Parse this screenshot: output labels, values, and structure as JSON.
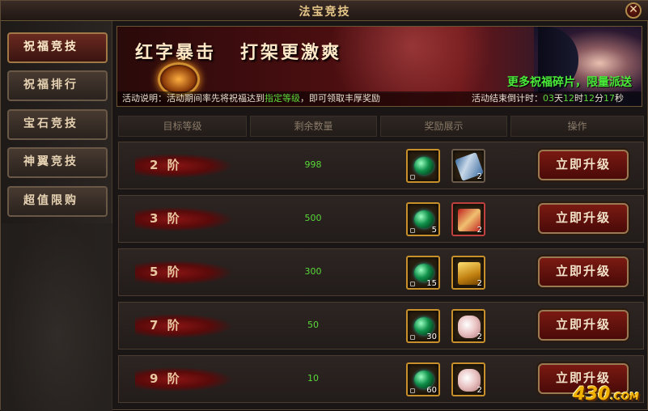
{
  "window": {
    "title": "法宝竞技",
    "close_icon": "close-icon"
  },
  "sidebar": {
    "items": [
      {
        "label": "祝福竞技",
        "active": true
      },
      {
        "label": "祝福排行",
        "active": false
      },
      {
        "label": "宝石竞技",
        "active": false
      },
      {
        "label": "神翼竞技",
        "active": false
      },
      {
        "label": "超值限购",
        "active": false
      }
    ]
  },
  "banner": {
    "slogan_1": "红字暴击",
    "slogan_2": "打架更激爽",
    "promo": "更多祝福碎片，限量派送",
    "description_prefix": "活动说明：活动期间率先将祝福达到",
    "description_highlight": "指定等级",
    "description_suffix": "，即可领取丰厚奖励",
    "countdown_label": "活动结束倒计时：",
    "countdown": {
      "days": "03",
      "days_unit": "天",
      "hours": "12",
      "hours_unit": "时",
      "minutes": "12",
      "minutes_unit": "分",
      "seconds": "17",
      "seconds_unit": "秒"
    }
  },
  "table": {
    "headers": [
      "目标等级",
      "剩余数量",
      "奖励展示",
      "操作"
    ],
    "rows": [
      {
        "level": "2 阶",
        "remaining": "998",
        "rewards": [
          {
            "icon": "green-gem-icon",
            "count": ""
          },
          {
            "icon": "blue-scroll-icon",
            "count": "2"
          }
        ],
        "action": "立即升级"
      },
      {
        "level": "3 阶",
        "remaining": "500",
        "rewards": [
          {
            "icon": "green-gem-icon",
            "count": "5"
          },
          {
            "icon": "red-scroll-icon",
            "count": "2"
          }
        ],
        "action": "立即升级"
      },
      {
        "level": "5 阶",
        "remaining": "300",
        "rewards": [
          {
            "icon": "green-gem-icon",
            "count": "15"
          },
          {
            "icon": "gold-bar-icon",
            "count": "2"
          }
        ],
        "action": "立即升级"
      },
      {
        "level": "7 阶",
        "remaining": "50",
        "rewards": [
          {
            "icon": "green-gem-icon",
            "count": "30"
          },
          {
            "icon": "pink-stone-icon",
            "count": "2"
          }
        ],
        "action": "立即升级"
      },
      {
        "level": "9 阶",
        "remaining": "10",
        "rewards": [
          {
            "icon": "green-gem-icon",
            "count": "60"
          },
          {
            "icon": "pink-stone-icon",
            "count": "2"
          }
        ],
        "action": "立即升级"
      }
    ]
  },
  "watermark": {
    "main": "430",
    "suffix": ".COM"
  }
}
